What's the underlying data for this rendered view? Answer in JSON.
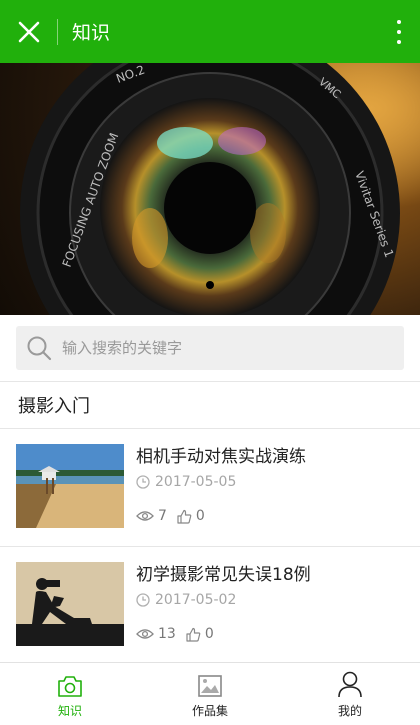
{
  "header": {
    "title": "知识",
    "bg_color": "#21b00c"
  },
  "banner": {
    "lens_ring_text_left": "FOCUSING AUTO ZOOM",
    "lens_ring_text_top": "NO.2",
    "lens_ring_text_right": "Vivitar Series 1",
    "lens_ring_text_vmc": "VMC"
  },
  "search": {
    "placeholder": "输入搜索的关键字"
  },
  "section": {
    "title": "摄影入门"
  },
  "articles": [
    {
      "title": "相机手动对焦实战演练",
      "date": "2017-05-05",
      "views": "7",
      "likes": "0"
    },
    {
      "title": "初学摄影常见失误18例",
      "date": "2017-05-02",
      "views": "13",
      "likes": "0"
    }
  ],
  "tabs": [
    {
      "label": "知识",
      "active": true
    },
    {
      "label": "作品集",
      "active": false
    },
    {
      "label": "我的",
      "active": false
    }
  ],
  "colors": {
    "accent": "#21b00c",
    "muted": "#a6a6a6"
  }
}
